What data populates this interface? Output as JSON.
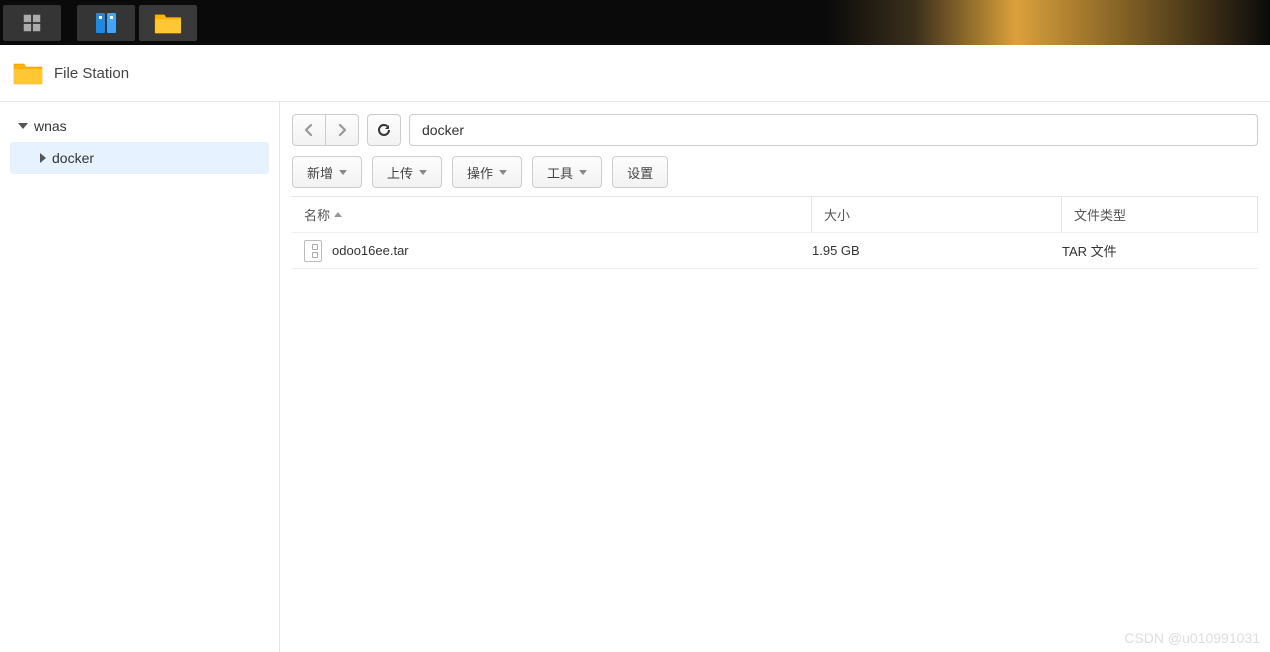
{
  "app_title": "File Station",
  "sidebar": {
    "root": "wnas",
    "child": "docker"
  },
  "path": "docker",
  "toolbar": {
    "new": "新增",
    "upload": "上传",
    "action": "操作",
    "tools": "工具",
    "settings": "设置"
  },
  "columns": {
    "name": "名称",
    "size": "大小",
    "type": "文件类型"
  },
  "files": [
    {
      "name": "odoo16ee.tar",
      "size": "1.95 GB",
      "type": "TAR 文件"
    }
  ],
  "watermark": "CSDN @u010991031"
}
